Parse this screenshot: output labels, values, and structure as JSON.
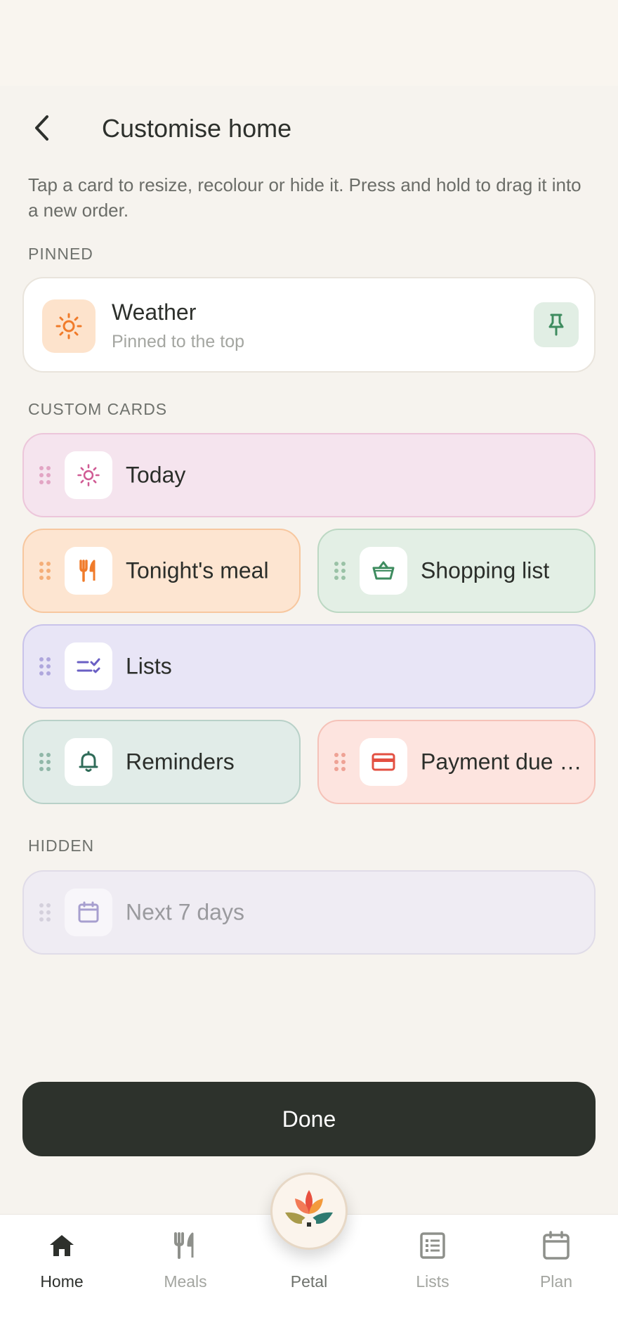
{
  "header": {
    "title": "Customise home"
  },
  "intro": "Tap a card to resize, recolour or hide it. Press and hold to drag it into a new order.",
  "sections": {
    "pinned": "PINNED",
    "custom": "CUSTOM CARDS",
    "hidden": "HIDDEN"
  },
  "pinned": {
    "title": "Weather",
    "subtitle": "Pinned to the top"
  },
  "cards": {
    "today": "Today",
    "tonight_meal": "Tonight's meal",
    "shopping_list": "Shopping list",
    "lists": "Lists",
    "reminders": "Reminders",
    "payment_due": "Payment due …"
  },
  "hidden_cards": {
    "next7": "Next 7 days"
  },
  "done_label": "Done",
  "tabbar": {
    "home": "Home",
    "meals": "Meals",
    "petal": "Petal",
    "lists": "Lists",
    "plan": "Plan"
  },
  "colors": {
    "accent_orange": "#f07b2a",
    "accent_green": "#3e8c5f",
    "accent_purple": "#6a5fc4",
    "accent_pink": "#d05b94",
    "accent_red": "#e35042",
    "dark": "#2d322c"
  },
  "icons": {
    "weather": "sun-icon",
    "today": "sun-icon",
    "tonight_meal": "fork-knife-icon",
    "shopping_list": "basket-icon",
    "lists": "checklist-icon",
    "reminders": "bell-icon",
    "payment_due": "credit-card-icon",
    "next7": "calendar-icon",
    "pin": "pin-icon",
    "home": "home-icon",
    "meals": "fork-knife-icon",
    "lists_tab": "list-icon",
    "plan": "calendar-icon"
  }
}
